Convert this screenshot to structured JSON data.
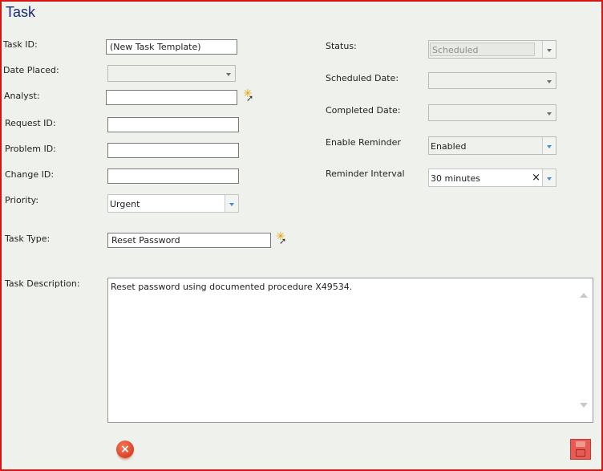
{
  "title": "Task",
  "labels": {
    "task_id": "Task ID:",
    "date_placed": "Date Placed:",
    "analyst": "Analyst:",
    "request_id": "Request ID:",
    "problem_id": "Problem ID:",
    "change_id": "Change ID:",
    "priority": "Priority:",
    "task_type": "Task Type:",
    "task_description": "Task Description:",
    "status": "Status:",
    "scheduled_date": "Scheduled Date:",
    "completed_date": "Completed Date:",
    "enable_reminder": "Enable Reminder",
    "reminder_interval": "Reminder Interval"
  },
  "values": {
    "task_id": "(New Task Template)",
    "date_placed": "",
    "analyst": "",
    "request_id": "",
    "problem_id": "",
    "change_id": "",
    "priority": "Urgent",
    "task_type": "Reset Password",
    "task_description": "Reset password using documented procedure X49534.",
    "status": "Scheduled",
    "scheduled_date": "",
    "completed_date": "",
    "enable_reminder": "Enabled",
    "reminder_interval": "30 minutes"
  },
  "icons": {
    "analyst_lookup": "star-cursor-icon",
    "task_type_lookup": "star-cursor-icon",
    "cancel": "red-circle-x-icon",
    "save": "floppy-disk-icon"
  },
  "colors": {
    "frame_border": "#d91414",
    "background": "#eef1ec",
    "title": "#1b2a7a",
    "dropdown_accent": "#3f8fd1"
  }
}
